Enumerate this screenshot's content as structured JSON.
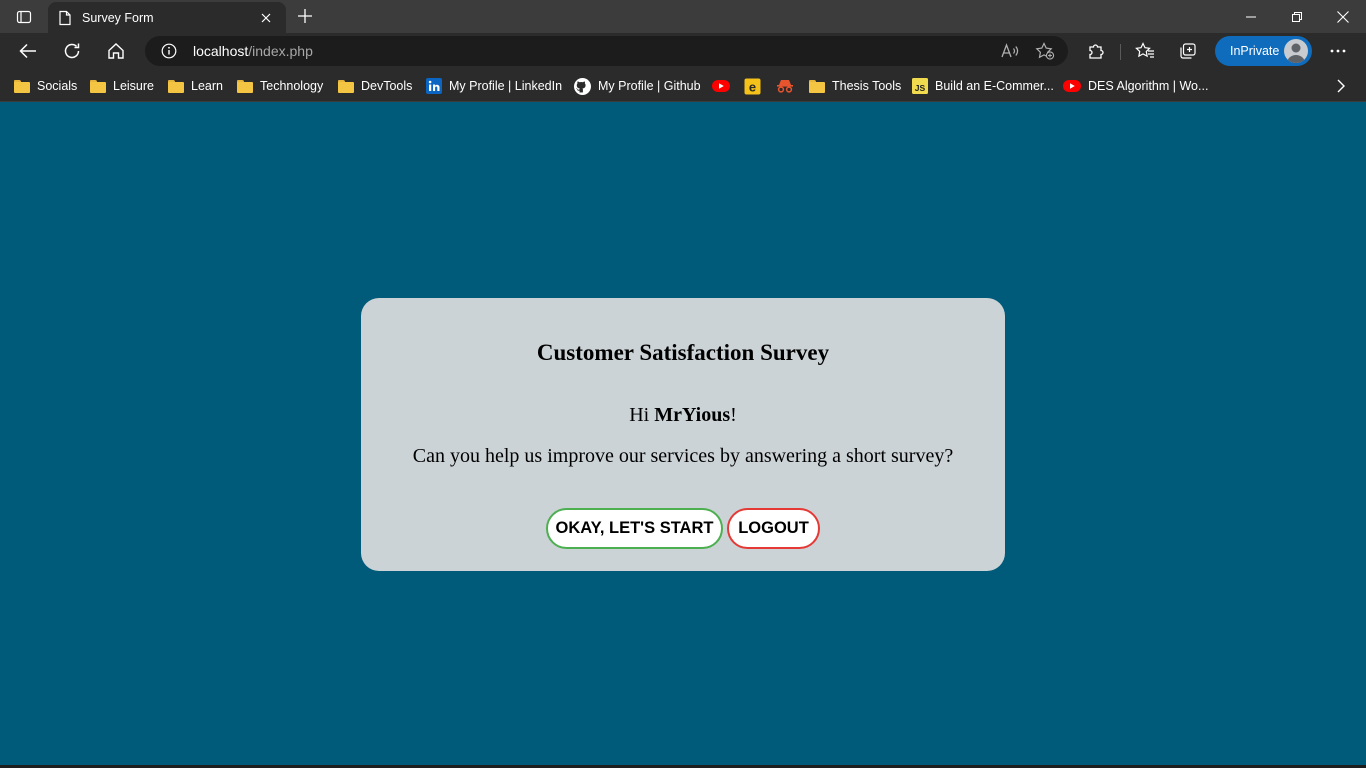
{
  "browser": {
    "tab_title": "Survey Form",
    "url_host": "localhost",
    "url_path": "/index.php",
    "inprivate_label": "InPrivate",
    "accent_color": "#0f6cbd"
  },
  "bookmarks": [
    {
      "label": "Socials",
      "icon": "folder-icon"
    },
    {
      "label": "Leisure",
      "icon": "folder-icon"
    },
    {
      "label": "Learn",
      "icon": "folder-icon"
    },
    {
      "label": "Technology",
      "icon": "folder-icon"
    },
    {
      "label": "DevTools",
      "icon": "folder-icon"
    },
    {
      "label": "My Profile | LinkedIn",
      "icon": "linkedin-icon"
    },
    {
      "label": "My Profile | Github",
      "icon": "github-icon"
    },
    {
      "label": "",
      "icon": "youtube-icon"
    },
    {
      "label": "",
      "icon": "edge-e-icon"
    },
    {
      "label": "",
      "icon": "incognito-icon"
    },
    {
      "label": "Thesis Tools",
      "icon": "folder-icon"
    },
    {
      "label": "Build an E-Commer...",
      "icon": "js-icon"
    },
    {
      "label": "DES Algorithm | Wo...",
      "icon": "youtube-icon"
    }
  ],
  "survey": {
    "title": "Customer Satisfaction Survey",
    "greeting_prefix": "Hi ",
    "username": "MrYious",
    "greeting_suffix": "!",
    "question": "Can you help us improve our services by answering a short survey?",
    "start_label": "OKAY, LET'S START",
    "logout_label": "LOGOUT",
    "page_background": "#005b7a",
    "card_background": "#ccd3d6",
    "start_border_color": "#4caf50",
    "logout_border_color": "#e53935"
  }
}
